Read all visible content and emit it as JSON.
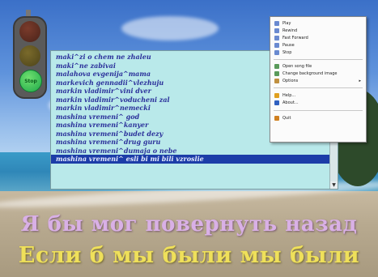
{
  "songs": [
    "maki^zi o chem ne zhaleu",
    "maki^ne zabivai",
    "malahova evgenija^mama",
    "markevich gennadii^vlezhuju",
    "markin vladimir^vini dver",
    "markin vladimir^voducheni zal",
    "markin vladimir^nemecki",
    "mashina vremeni^ god",
    "mashina vremeni^kanyer",
    "mashina vremeni^budet dezy",
    "mashina vremeni^drug guru",
    "mashina vremeni^dumaja o nebe",
    "mashina vremeni^ esli bi mi bili vzroslie"
  ],
  "selected_index": 12,
  "menu": {
    "items": [
      {
        "label": "Play",
        "icon": "play-icon",
        "color": "#6a8ad0"
      },
      {
        "label": "Rewind",
        "icon": "rewind-icon",
        "color": "#6a8ad0"
      },
      {
        "label": "Fast Forward",
        "icon": "fast-forward-icon",
        "color": "#6a8ad0"
      },
      {
        "label": "Pause",
        "icon": "pause-icon",
        "color": "#6a8ad0"
      },
      {
        "label": "Stop",
        "icon": "stop-icon",
        "color": "#6a8ad0"
      },
      {
        "label": "Open song file",
        "icon": "open-file-icon",
        "color": "#5a9a5a"
      },
      {
        "label": "Change background image",
        "icon": "image-icon",
        "color": "#5a9a5a"
      },
      {
        "label": "Options",
        "icon": "options-icon",
        "color": "#c09040",
        "submenu_arrow": "▸"
      },
      {
        "label": "Help...",
        "icon": "help-icon",
        "color": "#e0a020"
      },
      {
        "label": "About...",
        "icon": "about-icon",
        "color": "#3060c0"
      },
      {
        "label": "Quit",
        "icon": "quit-icon",
        "color": "#d08020"
      }
    ]
  },
  "traffic_light": {
    "green_label": "Stop"
  },
  "lyrics": {
    "line1": "Я бы мог повернуть назад",
    "line2": "Если б мы были мы были"
  }
}
